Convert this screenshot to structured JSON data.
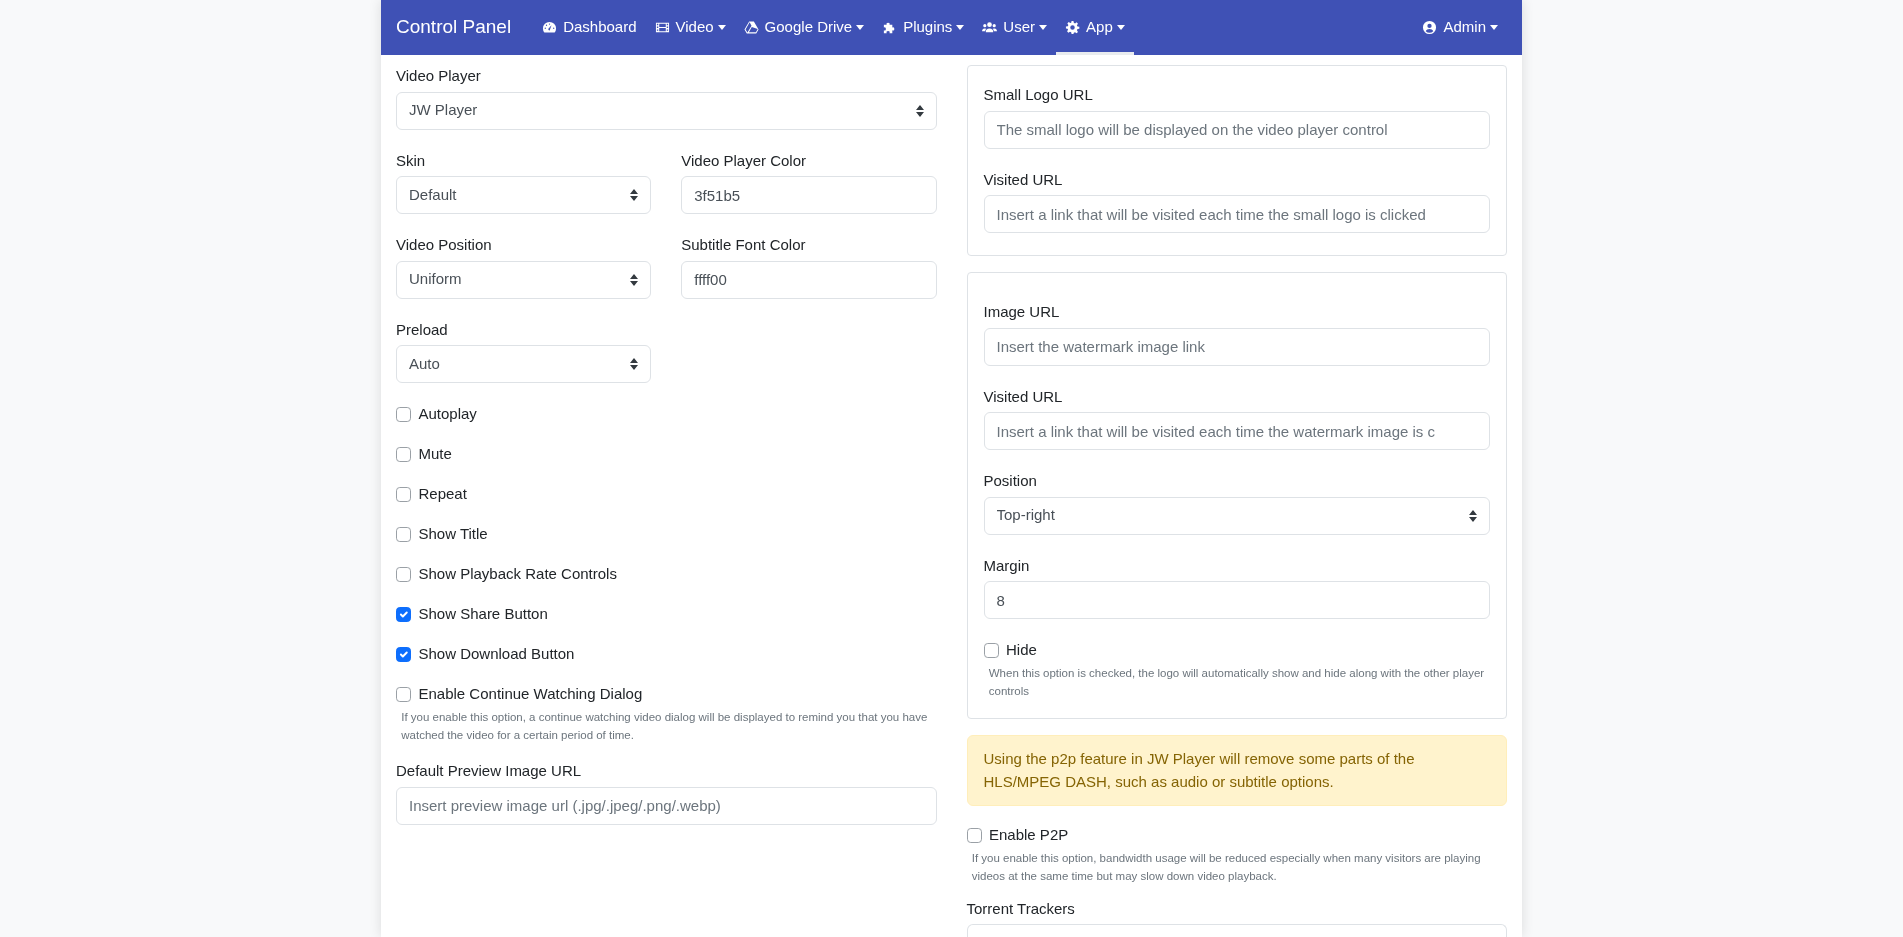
{
  "navbar": {
    "brand": "Control Panel",
    "items": [
      {
        "label": "Dashboard",
        "dropdown": false,
        "selected": false
      },
      {
        "label": "Video",
        "dropdown": true,
        "selected": false
      },
      {
        "label": "Google Drive",
        "dropdown": true,
        "selected": false
      },
      {
        "label": "Plugins",
        "dropdown": true,
        "selected": false
      },
      {
        "label": "User",
        "dropdown": true,
        "selected": false
      },
      {
        "label": "App",
        "dropdown": true,
        "selected": true
      }
    ],
    "user_menu": {
      "label": "Admin",
      "dropdown": true
    }
  },
  "player_settings": {
    "rows": [
      [
        {
          "kind": "select",
          "label": "Video Player",
          "value": "JW Player"
        }
      ],
      [
        {
          "kind": "select",
          "label": "Skin",
          "value": "Default"
        },
        {
          "kind": "input",
          "label": "Video Player Color",
          "value": "3f51b5"
        }
      ],
      [
        {
          "kind": "select",
          "label": "Video Position",
          "value": "Uniform"
        },
        {
          "kind": "input",
          "label": "Subtitle Font Color",
          "value": "ffff00"
        }
      ],
      [
        {
          "kind": "select",
          "label": "Preload",
          "value": "Auto"
        }
      ]
    ],
    "checkboxes": [
      {
        "label": "Autoplay",
        "checked": false
      },
      {
        "label": "Mute",
        "checked": false
      },
      {
        "label": "Repeat",
        "checked": false
      },
      {
        "label": "Show Title",
        "checked": false
      },
      {
        "label": "Show Playback Rate Controls",
        "checked": false
      },
      {
        "label": "Show Share Button",
        "checked": true
      },
      {
        "label": "Show Download Button",
        "checked": true
      },
      {
        "label": "Enable Continue Watching Dialog",
        "checked": false,
        "help": "If you enable this option, a continue watching video dialog will be displayed to remind you that you have watched the video for a certain period of time."
      }
    ],
    "preview_image": {
      "label": "Default Preview Image URL",
      "placeholder": "Insert preview image url (.jpg/.jpeg/.png/.webp)"
    }
  },
  "logo_card": {
    "fields": [
      {
        "kind": "input",
        "label": "Small Logo URL",
        "placeholder": "The small logo will be displayed on the video player control"
      },
      {
        "kind": "input",
        "label": "Visited URL",
        "placeholder": "Insert a link that will be visited each time the small logo is clicked"
      }
    ]
  },
  "watermark_card": {
    "fields": [
      {
        "kind": "input",
        "label": "Image URL",
        "placeholder": "Insert the watermark image link"
      },
      {
        "kind": "input",
        "label": "Visited URL",
        "placeholder": "Insert a link that will be visited each time the watermark image is c"
      },
      {
        "kind": "select",
        "label": "Position",
        "value": "Top-right"
      },
      {
        "kind": "input",
        "label": "Margin",
        "value": "8"
      }
    ],
    "hide": {
      "label": "Hide",
      "checked": false,
      "help": "When this option is checked, the logo will automatically show and hide along with the other player controls"
    }
  },
  "p2p_alert": "Using the p2p feature in JW Player will remove some parts of the HLS/MPEG DASH, such as audio or subtitle options.",
  "p2p": {
    "label": "Enable P2P",
    "checked": false,
    "help": "If you enable this option, bandwidth usage will be reduced especially when many visitors are playing videos at the same time but may slow down video playback."
  },
  "torrent_trackers": {
    "label": "Torrent Trackers"
  }
}
